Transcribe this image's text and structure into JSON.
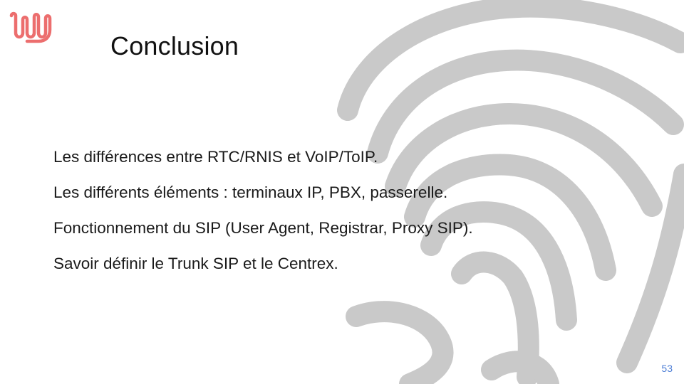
{
  "slide": {
    "title": "Conclusion",
    "bullets": [
      "Les différences entre RTC/RNIS et VoIP/ToIP.",
      "Les différents éléments : terminaux IP, PBX,  passerelle.",
      "Fonctionnement du SIP (User Agent, Registrar, Proxy SIP).",
      "Savoir définir le Trunk SIP et le Centrex."
    ],
    "page_number": "53"
  },
  "colors": {
    "logo": "#ec6e6e",
    "fingerprint": "#c9c9c9",
    "page_number": "#4f7fd6"
  },
  "icons": {
    "logo": "wavy-line-logo",
    "background": "fingerprint-graphic"
  }
}
